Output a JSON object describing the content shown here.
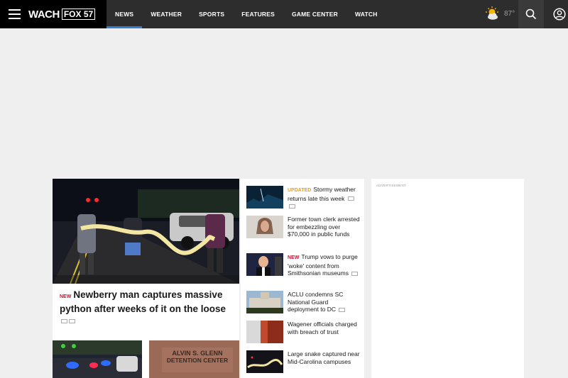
{
  "brand": {
    "name": "WACH",
    "sub": "FOX 57"
  },
  "nav": [
    {
      "label": "NEWS",
      "active": true
    },
    {
      "label": "WEATHER",
      "active": false
    },
    {
      "label": "SPORTS",
      "active": false
    },
    {
      "label": "FEATURES",
      "active": false
    },
    {
      "label": "GAME CENTER",
      "active": false
    },
    {
      "label": "WATCH",
      "active": false
    }
  ],
  "weather": {
    "temp": "87°",
    "icon": "partly-cloudy-sun-icon"
  },
  "main": {
    "tag": "NEW",
    "headline": "Newberry man captures massive python after weeks of it on the loose"
  },
  "list": [
    {
      "tag": "UPDATED",
      "tag_type": "updated",
      "title": "Stormy weather returns late this week"
    },
    {
      "tag": "",
      "tag_type": "",
      "title": "Former town clerk arrested for embezzling over $70,000 in public funds"
    },
    {
      "tag": "NEW",
      "tag_type": "new",
      "title": "Trump vows to purge 'woke' content from Smithsonian museums"
    },
    {
      "tag": "",
      "tag_type": "",
      "title": "ACLU condemns SC National Guard deployment to DC"
    },
    {
      "tag": "",
      "tag_type": "",
      "title": "Wagener officials charged with breach of trust"
    },
    {
      "tag": "",
      "tag_type": "",
      "title": "Large snake captured near Mid-Carolina campuses"
    }
  ],
  "ad": {
    "label": "ADVERTISEMENT"
  },
  "thumb_b_sign": {
    "line1": "ALVIN S. GLENN",
    "line2": "DETENTION CENTER"
  },
  "colors": {
    "accent": "#2f7fd3",
    "new_tag": "#c8102e",
    "updated_tag": "#f39c12"
  }
}
